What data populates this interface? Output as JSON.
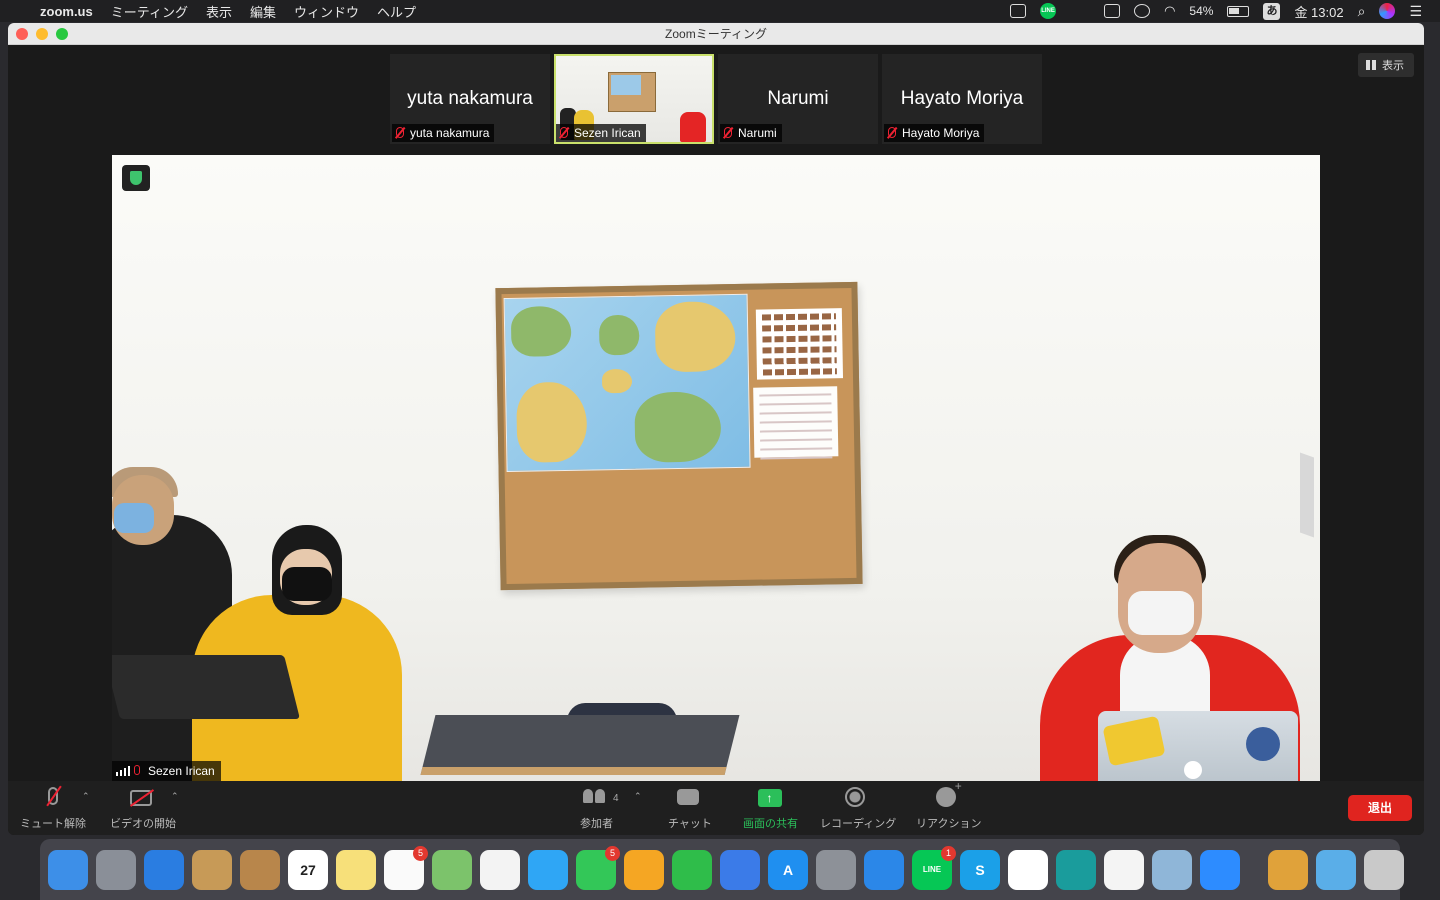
{
  "menubar": {
    "app_name": "zoom.us",
    "menus": [
      "ミーティング",
      "表示",
      "編集",
      "ウィンドウ",
      "ヘルプ"
    ],
    "line_icon_text": "LINE",
    "battery": "54%",
    "ime": "あ",
    "clock": "金 13:02",
    "icons": [
      "apple-icon",
      "zoom-video-icon",
      "line-icon",
      "screen-icon",
      "dnd-icon",
      "wifi-icon",
      "battery-icon",
      "ime-icon",
      "search-icon",
      "siri-icon",
      "control-center-icon"
    ]
  },
  "window": {
    "title": "Zoomミーティング",
    "view_button": "表示"
  },
  "gallery": [
    {
      "display_name": "yuta nakamura",
      "label": "yuta nakamura",
      "muted": true,
      "video": false
    },
    {
      "display_name": "",
      "label": "Sezen Irican",
      "muted": true,
      "video": true,
      "active": true
    },
    {
      "display_name": "Narumi",
      "label": "Narumi",
      "muted": true,
      "video": false
    },
    {
      "display_name": "Hayato Moriya",
      "label": "Hayato Moriya",
      "muted": true,
      "video": false
    }
  ],
  "main_video": {
    "speaker_label": "Sezen Irican"
  },
  "toolbar": {
    "mute_label": "ミュート解除",
    "video_label": "ビデオの開始",
    "participants_label": "参加者",
    "participants_count": "4",
    "chat_label": "チャット",
    "share_label": "画面の共有",
    "record_label": "レコーディング",
    "reactions_label": "リアクション",
    "leave_label": "退出",
    "share_color": "#2bbf5a",
    "leave_color": "#e0241f"
  },
  "dock": {
    "apps": [
      {
        "name": "finder-icon",
        "color": "#3d8fe8",
        "glyph": ""
      },
      {
        "name": "launchpad-icon",
        "color": "#8a8f98",
        "glyph": ""
      },
      {
        "name": "safari-icon",
        "color": "#2a7de1",
        "glyph": ""
      },
      {
        "name": "mail-icon",
        "color": "#c79a57",
        "glyph": ""
      },
      {
        "name": "contacts-icon",
        "color": "#b8864b",
        "glyph": ""
      },
      {
        "name": "calendar-icon",
        "color": "#ffffff",
        "glyph": "27",
        "text_color": "#222"
      },
      {
        "name": "notes-icon",
        "color": "#f7e07a",
        "glyph": ""
      },
      {
        "name": "reminders-icon",
        "color": "#fafafa",
        "glyph": "",
        "badge": "5"
      },
      {
        "name": "maps-icon",
        "color": "#7cc36b",
        "glyph": ""
      },
      {
        "name": "photos-icon",
        "color": "#f3f3f3",
        "glyph": ""
      },
      {
        "name": "messages-icon",
        "color": "#2fa6f5",
        "glyph": ""
      },
      {
        "name": "facetime-icon",
        "color": "#33c758",
        "glyph": "",
        "badge": "5"
      },
      {
        "name": "pages-icon",
        "color": "#f5a623",
        "glyph": ""
      },
      {
        "name": "numbers-icon",
        "color": "#2fbd4a",
        "glyph": ""
      },
      {
        "name": "keynote-icon",
        "color": "#3b7be8",
        "glyph": ""
      },
      {
        "name": "app-store-icon",
        "color": "#1f8ff0",
        "glyph": "A"
      },
      {
        "name": "system-preferences-icon",
        "color": "#8d9198",
        "glyph": ""
      },
      {
        "name": "bookmark-icon",
        "color": "#2b87e8",
        "glyph": ""
      },
      {
        "name": "line-app-icon",
        "color": "#06c755",
        "glyph": "LINE",
        "badge": "1"
      },
      {
        "name": "skype-icon",
        "color": "#1ba0e8",
        "glyph": "S"
      },
      {
        "name": "slack-icon",
        "color": "#ffffff",
        "glyph": ""
      },
      {
        "name": "edge-icon",
        "color": "#1a9c9c",
        "glyph": ""
      },
      {
        "name": "chrome-icon",
        "color": "#f4f4f4",
        "glyph": ""
      },
      {
        "name": "preview-icon",
        "color": "#8fb6d8",
        "glyph": ""
      },
      {
        "name": "zoom-icon",
        "color": "#2d8cff",
        "glyph": ""
      },
      {
        "name": "archive-icon",
        "color": "#e0a23a",
        "glyph": ""
      },
      {
        "name": "applications-folder-icon",
        "color": "#5aaee8",
        "glyph": ""
      },
      {
        "name": "trash-icon",
        "color": "#c9c9c9",
        "glyph": ""
      }
    ]
  }
}
